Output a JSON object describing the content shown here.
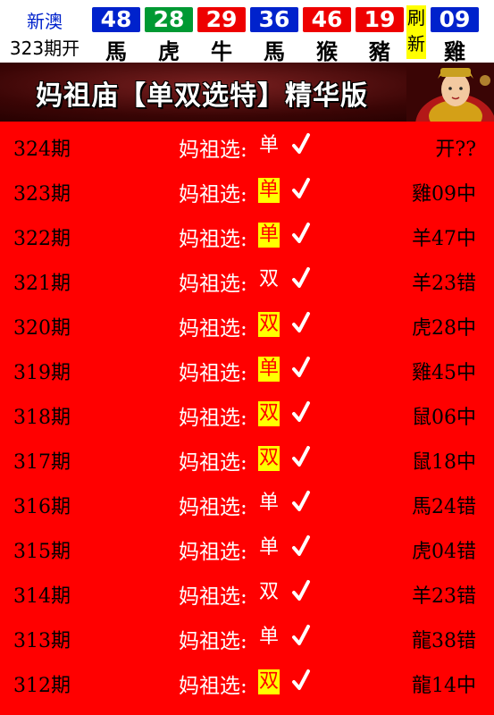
{
  "header": {
    "site_name": "新澳",
    "issue": "323期开",
    "balls": [
      {
        "num": "48",
        "zodiac": "馬",
        "color": "#0022cc"
      },
      {
        "num": "28",
        "zodiac": "虎",
        "color": "#009933"
      },
      {
        "num": "29",
        "zodiac": "牛",
        "color": "#ee0000"
      },
      {
        "num": "36",
        "zodiac": "馬",
        "color": "#0022cc"
      },
      {
        "num": "46",
        "zodiac": "猴",
        "color": "#ee0000"
      },
      {
        "num": "19",
        "zodiac": "豬",
        "color": "#ee0000"
      },
      {
        "num": "09",
        "zodiac": "雞",
        "color": "#0022cc"
      }
    ],
    "refresh_top": "刷",
    "refresh_bottom": "新"
  },
  "banner": {
    "title": "妈祖庙【单双选特】精华版"
  },
  "rows": [
    {
      "period": "324期",
      "label": "妈祖选:",
      "pick": "单",
      "highlight": false,
      "result": "开??"
    },
    {
      "period": "323期",
      "label": "妈祖选:",
      "pick": "单",
      "highlight": true,
      "result": "雞09中"
    },
    {
      "period": "322期",
      "label": "妈祖选:",
      "pick": "单",
      "highlight": true,
      "result": "羊47中"
    },
    {
      "period": "321期",
      "label": "妈祖选:",
      "pick": "双",
      "highlight": false,
      "result": "羊23错"
    },
    {
      "period": "320期",
      "label": "妈祖选:",
      "pick": "双",
      "highlight": true,
      "result": "虎28中"
    },
    {
      "period": "319期",
      "label": "妈祖选:",
      "pick": "单",
      "highlight": true,
      "result": "雞45中"
    },
    {
      "period": "318期",
      "label": "妈祖选:",
      "pick": "双",
      "highlight": true,
      "result": "鼠06中"
    },
    {
      "period": "317期",
      "label": "妈祖选:",
      "pick": "双",
      "highlight": true,
      "result": "鼠18中"
    },
    {
      "period": "316期",
      "label": "妈祖选:",
      "pick": "单",
      "highlight": false,
      "result": "馬24错"
    },
    {
      "period": "315期",
      "label": "妈祖选:",
      "pick": "单",
      "highlight": false,
      "result": "虎04错"
    },
    {
      "period": "314期",
      "label": "妈祖选:",
      "pick": "双",
      "highlight": false,
      "result": "羊23错"
    },
    {
      "period": "313期",
      "label": "妈祖选:",
      "pick": "单",
      "highlight": false,
      "result": "龍38错"
    },
    {
      "period": "312期",
      "label": "妈祖选:",
      "pick": "双",
      "highlight": true,
      "result": "龍14中"
    }
  ]
}
